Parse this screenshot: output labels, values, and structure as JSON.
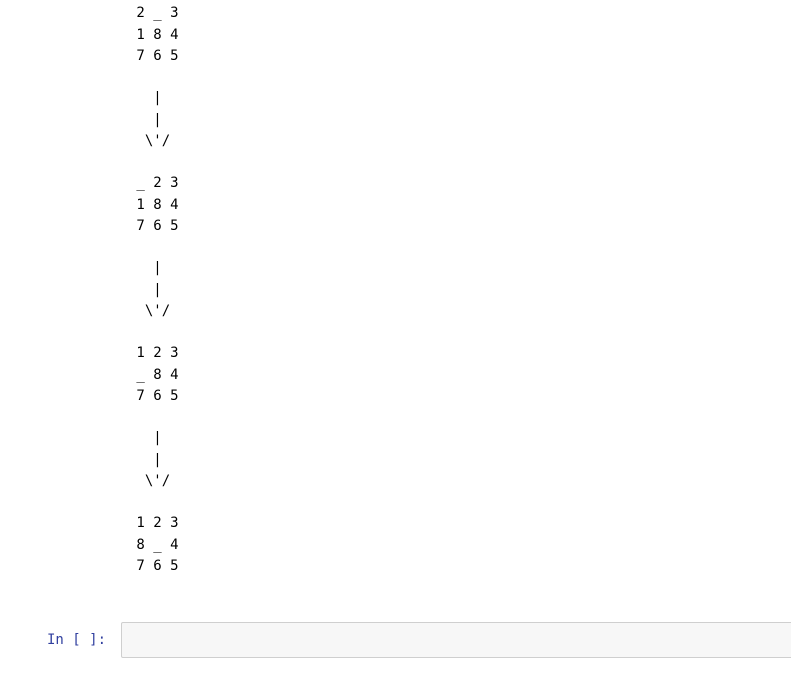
{
  "output": {
    "text": "   /\\\n 2 _ 3\n 1 8 4\n 7 6 5\n\n   |\n   |\n  \\'/\n\n _ 2 3\n 1 8 4\n 7 6 5\n\n   |\n   |\n  \\'/\n\n 1 2 3\n _ 8 4\n 7 6 5\n\n   |\n   |\n  \\'/\n\n 1 2 3\n 8 _ 4\n 7 6 5"
  },
  "input_cell": {
    "prompt": "In [ ]:",
    "code": ""
  }
}
